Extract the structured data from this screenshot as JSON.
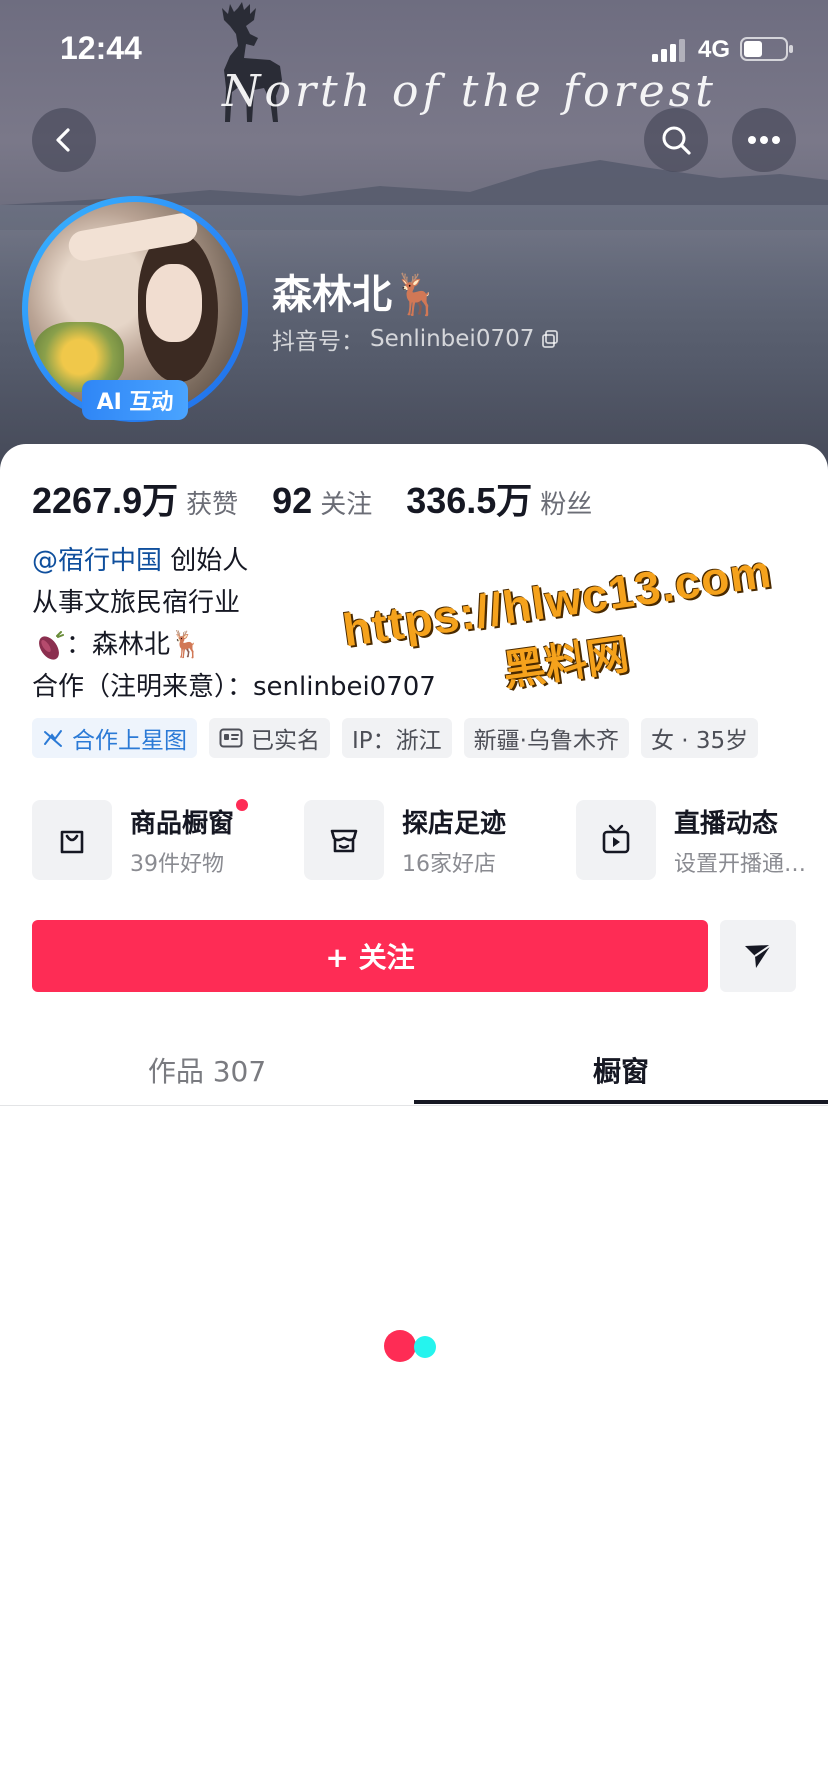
{
  "status_bar": {
    "time": "12:44",
    "network": "4G"
  },
  "cover": {
    "title": "North of the forest"
  },
  "header": {
    "back_icon": "chevron-left-icon",
    "search_icon": "search-icon",
    "more_icon": "more-icon"
  },
  "profile": {
    "name": "森林北🦌",
    "handle_label": "抖音号：",
    "handle_id": "Senlinbei0707",
    "ai_badge": "AI 互动"
  },
  "stats": [
    {
      "value": "2267.9万",
      "label": "获赞"
    },
    {
      "value": "92",
      "label": "关注"
    },
    {
      "value": "336.5万",
      "label": "粉丝"
    }
  ],
  "bio": {
    "mention": "@宿行中国",
    "role": " 创始人",
    "line2": "从事文旅民宿行业",
    "line3": "：森林北🦌",
    "line4": "合作（注明来意）：senlinbei0707"
  },
  "tags": [
    {
      "label": "合作上星图",
      "style": "blue"
    },
    {
      "label": "已实名",
      "style": "gray"
    },
    {
      "label": "IP：浙江",
      "style": "gray"
    },
    {
      "label": "新疆·乌鲁木齐",
      "style": "gray"
    },
    {
      "label": "女 · 35岁",
      "style": "gray"
    }
  ],
  "services": [
    {
      "title": "商品橱窗",
      "sub": "39件好物",
      "icon": "shopping-bag-icon",
      "has_dot": true
    },
    {
      "title": "探店足迹",
      "sub": "16家好店",
      "icon": "store-icon",
      "has_dot": false
    },
    {
      "title": "直播动态",
      "sub": "设置开播通…",
      "icon": "tv-icon",
      "has_dot": false
    }
  ],
  "actions": {
    "follow_label": "+ 关注",
    "share_icon": "send-icon"
  },
  "tabs": {
    "works_label": "作品 307",
    "shop_label": "橱窗",
    "active": "shop"
  },
  "watermark": {
    "url": "https://hlwc13.com",
    "site": "黑料网"
  },
  "colors": {
    "accent": "#fe2c55",
    "mention": "#0f4f9d",
    "avatar_ring": "#2c8bf7",
    "loader_second": "#25f4ee",
    "watermark": "#f5a21c"
  }
}
